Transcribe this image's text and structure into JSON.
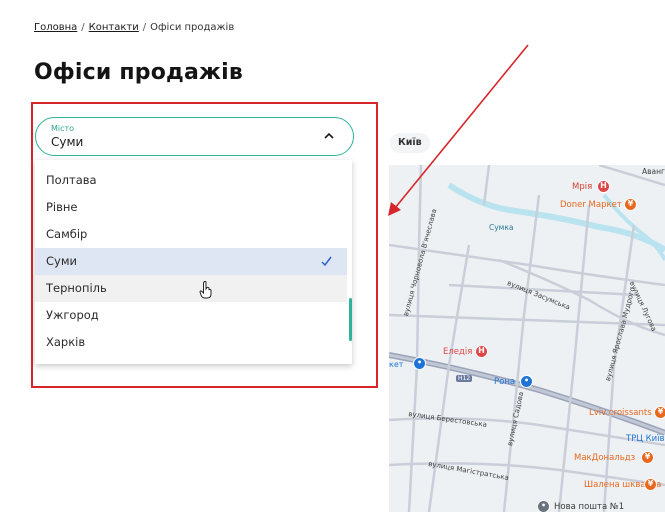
{
  "breadcrumb": {
    "items": [
      "Головна",
      "Контакти",
      "Офіси продажів"
    ],
    "separator": "/"
  },
  "page_title": "Офіси продажів",
  "city_select": {
    "label": "Місто",
    "value": "Суми"
  },
  "dropdown": {
    "options": [
      {
        "label": "Полтава",
        "state": "normal"
      },
      {
        "label": "Рівне",
        "state": "normal"
      },
      {
        "label": "Самбір",
        "state": "normal"
      },
      {
        "label": "Суми",
        "state": "selected"
      },
      {
        "label": "Тернопіль",
        "state": "hover"
      },
      {
        "label": "Ужгород",
        "state": "normal"
      },
      {
        "label": "Харків",
        "state": "normal"
      }
    ]
  },
  "map": {
    "city_chip": "Київ",
    "street_labels": {
      "chornovola": "вулиця Чорновола В'ячеслава",
      "sumka": "Сумка",
      "zasumska": "вулиця Засумська",
      "mudryi": "вулиця Ярослава Мудрого",
      "berestovska": "вулиця Берестовська",
      "sadova": "вулиця Садова",
      "mahistratska": "вулиця Магістратська",
      "h12": "H12",
      "avanhard": "Авангард",
      "luhova": "вулиця Лугова",
      "market_cut": "кет"
    },
    "pois": {
      "mriia": "Мрія",
      "doner": "Doner Маркет",
      "eledia": "Еледія",
      "rona": "Рона",
      "lviv": "Lviv croissants",
      "trc": "ТРЦ Київ",
      "mcd": "МакДональдз",
      "shkvarka": "Шалена шкварка",
      "nova": "Нова пошта №1"
    },
    "colors": {
      "background": "#eef1f4",
      "roads": "#c9ced8",
      "main_road": "#9aa3b8",
      "river": "#b8e3ef",
      "poi_orange": "#e8681f",
      "poi_red": "#e04545",
      "poi_blue": "#1e74d6"
    }
  },
  "annotation": {
    "box_color": "#d7262b",
    "arrow_color": "#d7262b"
  },
  "accent_color": "#2fb39a"
}
